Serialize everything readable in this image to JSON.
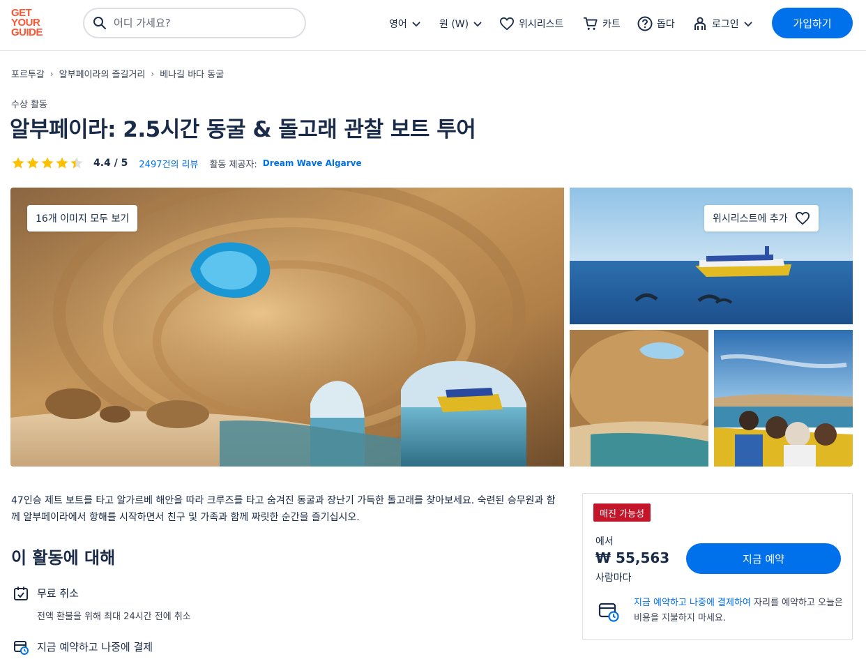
{
  "header": {
    "logo_lines": [
      "GET",
      "YOUR",
      "GUIDE"
    ],
    "search_placeholder": "어디 가세요?",
    "language": "영어",
    "currency": "원 (W)",
    "wishlist": "위시리스트",
    "cart": "카트",
    "help": "돕다",
    "login": "로그인",
    "signup": "가입하기"
  },
  "breadcrumb": [
    "포르투갈",
    "알부페이라의 즐길거리",
    "베나길 바다 동굴"
  ],
  "category": "수상 활동",
  "title": "알부페이라: 2.5시간 동굴 & 돌고래 관찰 보트 투어",
  "rating": {
    "value": 4.4,
    "display": "4.4 / 5",
    "reviews": "2497건의 리뷰",
    "provider_label": "활동 제공자:",
    "provider": "Dream Wave Algarve"
  },
  "gallery": {
    "view_all": "16개 이미지 모두 보기",
    "wishlist_add": "위시리스트에 추가"
  },
  "description": "47인승 제트 보트를 타고 알가르베 해안을 따라 크루즈를 타고 숨겨진 동굴과 장난기 가득한 돌고래를 찾아보세요. 숙련된 승무원과 함께 알부페이라에서 항해를 시작하면서 친구 및 가족과 함께 짜릿한 순간을 즐기십시오.",
  "about": {
    "title": "이 활동에 대해",
    "features": [
      {
        "title": "무료 취소",
        "subtitle": "전액 환불을 위해 최대 24시간 전에 취소"
      },
      {
        "title": "지금 예약하고 나중에 결제",
        "subtitle": ""
      }
    ]
  },
  "booking": {
    "badge": "매진 가능성",
    "from": "에서",
    "price": "₩ 55,563",
    "per": "사람마다",
    "book_now": "지금 예약",
    "reserve_link": "지금 예약하고 나중에 결제하여",
    "reserve_rest": " 자리를 예약하고 오늘은 비용을 지불하지 마세요."
  },
  "colors": {
    "accent": "#0071eb",
    "brand": "#ff5533",
    "badge": "#c4162a",
    "star": "#ffc000"
  }
}
